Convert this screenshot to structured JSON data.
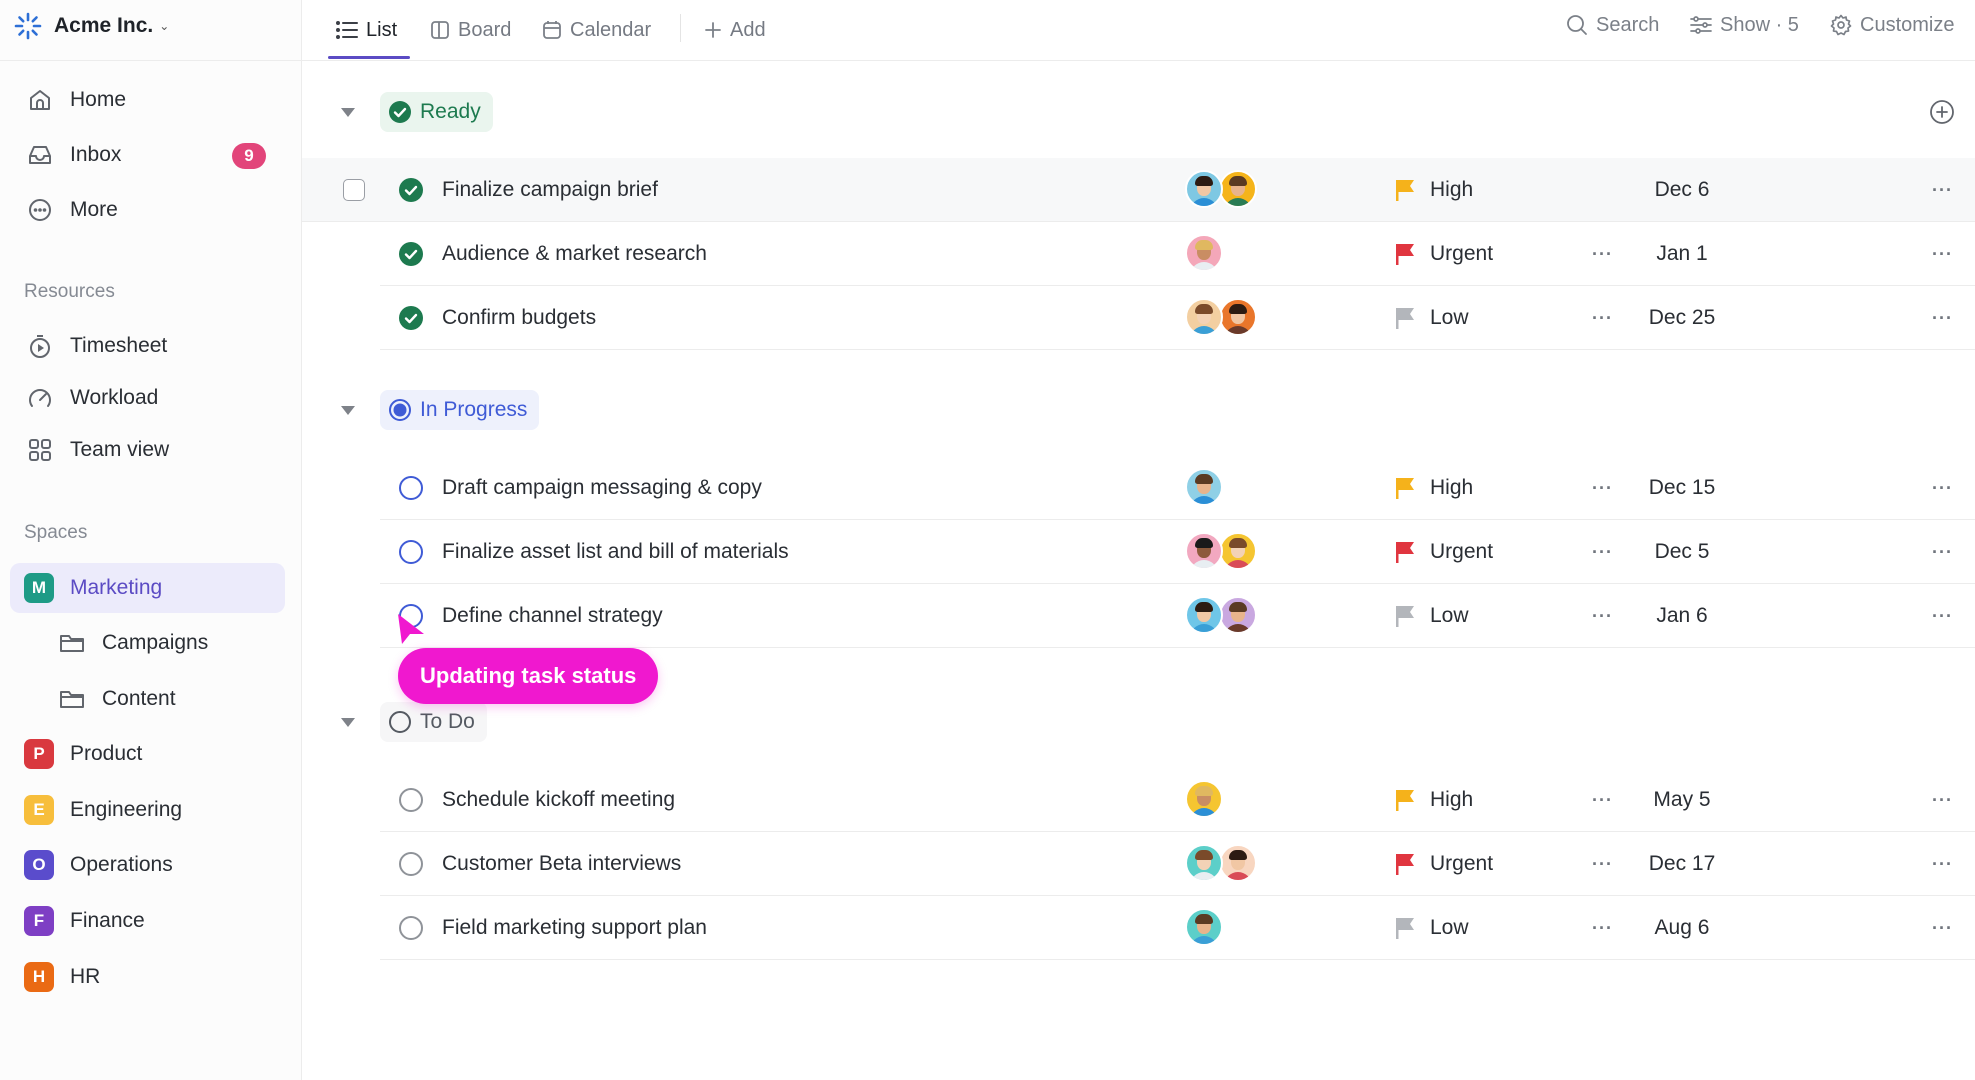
{
  "workspace": {
    "name": "Acme Inc.",
    "logo_icon": "spinner-logo-icon",
    "chevron_icon": "chevron-down-icon"
  },
  "sidebar": {
    "nav": [
      {
        "label": "Home",
        "icon": "home-icon"
      },
      {
        "label": "Inbox",
        "icon": "inbox-icon",
        "badge": "9"
      },
      {
        "label": "More",
        "icon": "more-circle-icon"
      }
    ],
    "resources_label": "Resources",
    "resources": [
      {
        "label": "Timesheet",
        "icon": "stopwatch-icon"
      },
      {
        "label": "Workload",
        "icon": "gauge-icon"
      },
      {
        "label": "Team view",
        "icon": "grid-icon"
      }
    ],
    "spaces_label": "Spaces",
    "spaces": [
      {
        "label": "Marketing",
        "initial": "M",
        "color": "#1e9b86",
        "active": true
      },
      {
        "label": "Campaigns",
        "icon": "folder-icon",
        "sub": true
      },
      {
        "label": "Content",
        "icon": "folder-icon",
        "sub": true
      },
      {
        "label": "Product",
        "initial": "P",
        "color": "#d9393f"
      },
      {
        "label": "Engineering",
        "initial": "E",
        "color": "#f7be3c"
      },
      {
        "label": "Operations",
        "initial": "O",
        "color": "#5a4ccc"
      },
      {
        "label": "Finance",
        "initial": "F",
        "color": "#7e3fc4"
      },
      {
        "label": "HR",
        "initial": "H",
        "color": "#ea6a14"
      }
    ],
    "badge_color": "#e2457a"
  },
  "topbar": {
    "tabs": [
      {
        "label": "List",
        "icon": "list-icon",
        "active": true
      },
      {
        "label": "Board",
        "icon": "board-icon"
      },
      {
        "label": "Calendar",
        "icon": "calendar-icon"
      }
    ],
    "add_label": "Add",
    "search_label": "Search",
    "show_label": "Show · 5",
    "customize_label": "Customize",
    "accent": "#5b4bc4"
  },
  "groups": [
    {
      "name": "Ready",
      "color": "#1d7a4f",
      "bg": "#eaf5ee",
      "status_icon": "check-circle-icon",
      "tasks": [
        {
          "title": "Finalize campaign brief",
          "priority": "High",
          "due": "Dec 6",
          "assignees": 2,
          "hover": true
        },
        {
          "title": "Audience & market research",
          "priority": "Urgent",
          "due": "Jan 1",
          "assignees": 1
        },
        {
          "title": "Confirm budgets",
          "priority": "Low",
          "due": "Dec 25",
          "assignees": 2
        }
      ]
    },
    {
      "name": "In Progress",
      "color": "#3f5bd6",
      "bg": "#eef1fc",
      "status_icon": "in-progress-circle-icon",
      "tasks": [
        {
          "title": "Draft campaign messaging & copy",
          "priority": "High",
          "due": "Dec 15",
          "assignees": 1
        },
        {
          "title": "Finalize asset list and bill of materials",
          "priority": "Urgent",
          "due": "Dec 5",
          "assignees": 2
        },
        {
          "title": "Define channel strategy",
          "priority": "Low",
          "due": "Jan 6",
          "assignees": 2
        }
      ]
    },
    {
      "name": "To Do",
      "color": "#555a62",
      "bg": "#f6f6f7",
      "status_icon": "empty-circle-icon",
      "tasks": [
        {
          "title": "Schedule kickoff meeting",
          "priority": "High",
          "due": "May 5",
          "assignees": 1
        },
        {
          "title": "Customer Beta interviews",
          "priority": "Urgent",
          "due": "Dec 17",
          "assignees": 2
        },
        {
          "title": "Field marketing support plan",
          "priority": "Low",
          "due": "Aug 6",
          "assignees": 1
        }
      ]
    }
  ],
  "priority_colors": {
    "High": "#f5b21b",
    "Urgent": "#e0353f",
    "Low": "#b3b6bb"
  },
  "tooltip": {
    "text": "Updating task status",
    "color": "#f018cf"
  }
}
